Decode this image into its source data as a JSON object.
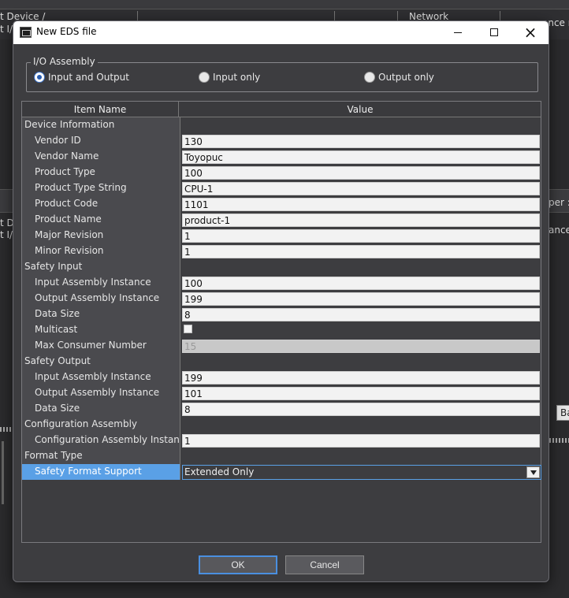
{
  "background": {
    "header_col1_line1": "t Device /",
    "header_col1_line2": "t I/",
    "header_col_network": "Network",
    "header_col_right": "ance r",
    "mid_left_line1": "t D",
    "mid_left_line2": "t I/",
    "mid_right_line1": "per :",
    "mid_right_line2": "ance r",
    "right_button": "Ba"
  },
  "dialog": {
    "title": "New EDS file",
    "icon": "app-icon",
    "minimize_icon": "minimize-icon",
    "maximize_icon": "maximize-icon",
    "close_glyph": "×"
  },
  "io_assembly": {
    "legend": "I/O Assembly",
    "options": [
      {
        "label": "Input and Output",
        "checked": true
      },
      {
        "label": "Input only",
        "checked": false
      },
      {
        "label": "Output only",
        "checked": false
      }
    ]
  },
  "grid": {
    "header_name": "Item Name",
    "header_value": "Value",
    "rows": [
      {
        "type": "category",
        "name": "Device Information"
      },
      {
        "type": "text",
        "name": "Vendor ID",
        "value": "130"
      },
      {
        "type": "text",
        "name": "Vendor Name",
        "value": "Toyopuc"
      },
      {
        "type": "text",
        "name": "Product Type",
        "value": "100"
      },
      {
        "type": "text",
        "name": "Product Type String",
        "value": "CPU-1"
      },
      {
        "type": "text",
        "name": "Product Code",
        "value": "1101"
      },
      {
        "type": "text",
        "name": "Product Name",
        "value": "product-1"
      },
      {
        "type": "text",
        "name": "Major Revision",
        "value": "1"
      },
      {
        "type": "text",
        "name": "Minor Revision",
        "value": "1"
      },
      {
        "type": "category",
        "name": "Safety Input"
      },
      {
        "type": "text",
        "name": "Input Assembly Instance",
        "value": "100"
      },
      {
        "type": "text",
        "name": "Output Assembly Instance",
        "value": "199"
      },
      {
        "type": "text",
        "name": "Data Size",
        "value": "8"
      },
      {
        "type": "checkbox",
        "name": "Multicast",
        "checked": false
      },
      {
        "type": "disabled",
        "name": "Max Consumer Number",
        "value": "15"
      },
      {
        "type": "category",
        "name": "Safety Output"
      },
      {
        "type": "text",
        "name": "Input Assembly Instance",
        "value": "199"
      },
      {
        "type": "text",
        "name": "Output Assembly Instance",
        "value": "101"
      },
      {
        "type": "text",
        "name": "Data Size",
        "value": "8"
      },
      {
        "type": "category",
        "name": "Configuration Assembly"
      },
      {
        "type": "text",
        "name": "Configuration Assembly Instance",
        "value": "1"
      },
      {
        "type": "category",
        "name": "Format Type"
      },
      {
        "type": "combo",
        "name": "Safety Format Support",
        "value": "Extended Only",
        "selected": true
      }
    ]
  },
  "buttons": {
    "ok": "OK",
    "cancel": "Cancel"
  },
  "colors": {
    "selection": "#5aa0e6",
    "dialog_bg": "#3d3d40",
    "ok_border": "#4a8fe0"
  }
}
